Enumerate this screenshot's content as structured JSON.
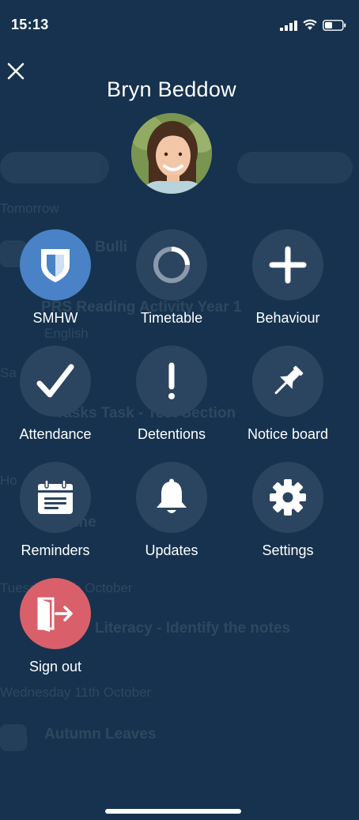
{
  "status_bar": {
    "time": "15:13"
  },
  "profile": {
    "name": "Bryn Beddow"
  },
  "menu": {
    "smhw": "SMHW",
    "timetable": "Timetable",
    "behaviour": "Behaviour",
    "attendance": "Attendance",
    "detentions": "Detentions",
    "notice_board": "Notice board",
    "reminders": "Reminders",
    "updates": "Updates",
    "settings": "Settings",
    "sign_out": "Sign out"
  },
  "colors": {
    "background": "#16324e",
    "menu_circle": "#2b4560",
    "active_circle": "#4a82c7",
    "sign_out_circle": "#d9606a"
  }
}
